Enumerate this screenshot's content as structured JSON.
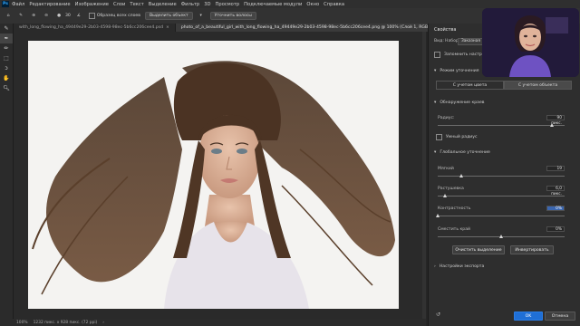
{
  "menubar": {
    "logo": "Ps",
    "items": [
      "Файл",
      "Редактирование",
      "Изображение",
      "Слои",
      "Текст",
      "Выделение",
      "Фильтр",
      "3D",
      "Просмотр",
      "Подключаемые модули",
      "Окно",
      "Справка"
    ]
  },
  "options_bar": {
    "brush_size": "30",
    "sample_all_layers": "Образец всех слоев",
    "select_subject": "Выделить объект",
    "refine_hair": "Уточнить волосы"
  },
  "tabs": [
    {
      "label": "with_long_flowing_ha_49449e29-2b03-4598-98ec-5b6cc206cee4.psd",
      "active": false
    },
    {
      "label": "photo_of_a_beautiful_girl_with_long_flowing_ha_49449e29-2b03-4598-98ec-5b6cc206cee4.png @ 100% (Слой 1, RGB/8*)",
      "active": true
    }
  ],
  "status": {
    "zoom": "100%",
    "doc_size": "1232 пикс. x 928 пикс. (72 ppi)"
  },
  "properties": {
    "title": "Свойства",
    "view_label": "Вид:",
    "nabor_label": "Набор:",
    "nabor_value": "Заказная",
    "remember_settings": "Запомнить настройки",
    "refine_mode": "Режим уточнения",
    "mode_color": "С учетом цвета",
    "mode_object": "С учетом объекта",
    "edge_detection": "Обнаружение краев",
    "radius_label": "Радиус:",
    "radius_value": "90 пикс.",
    "radius_fraction": 0.9,
    "smart_radius": "Умный радиус",
    "global_refinements": "Глобальное уточнение",
    "smooth_label": "Мягкий",
    "smooth_value": "19",
    "smooth_fraction": 0.19,
    "feather_label": "Растушевка",
    "feather_value": "6,0 пикс.",
    "feather_fraction": 0.06,
    "contrast_label": "Контрастность",
    "contrast_value": "0%",
    "contrast_fraction": 0.0,
    "shift_label": "Сместить край",
    "shift_value": "0%",
    "shift_fraction": 0.5,
    "clear_selection": "Очистить выделение",
    "invert": "Инвертировать",
    "output_settings": "Настройки экспорта",
    "ok": "OK",
    "cancel": "Отмена"
  }
}
